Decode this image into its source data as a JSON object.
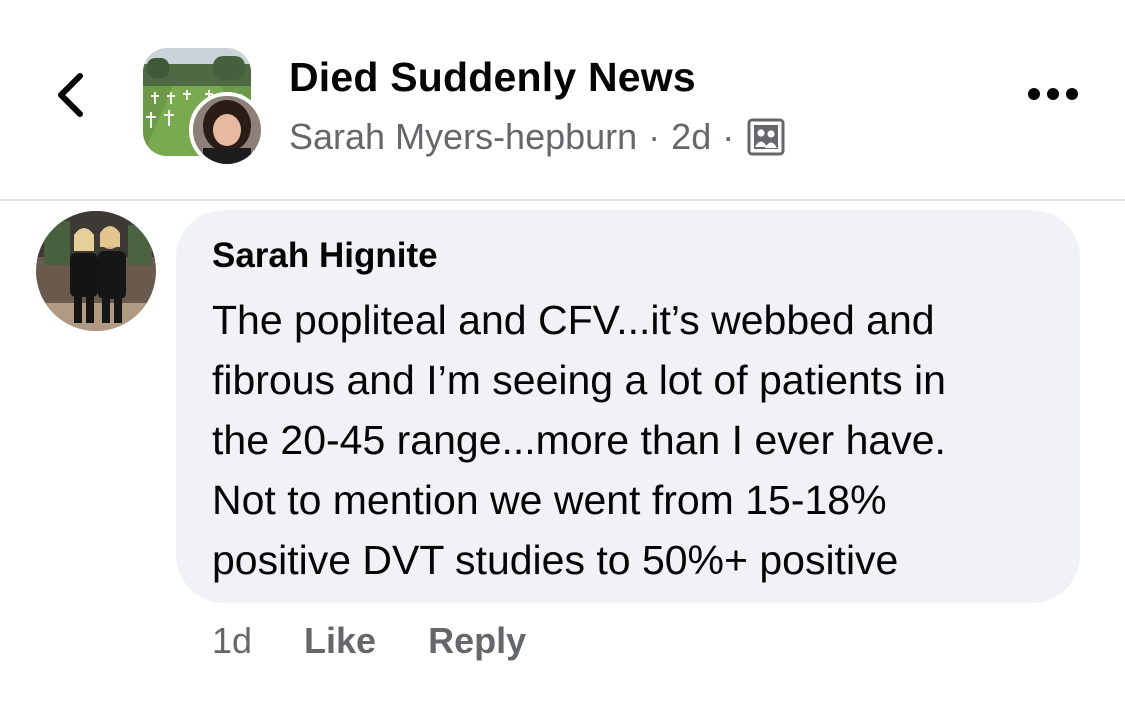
{
  "header": {
    "group_name": "Died Suddenly News",
    "poster_name": "Sarah Myers-hepburn",
    "separator": "·",
    "post_age": "2d",
    "back_icon": "chevron-left-icon",
    "more_icon": "more-horizontal-icon",
    "privacy_icon": "group-members-icon"
  },
  "comment": {
    "author": "Sarah Hignite",
    "lines": [
      "The popliteal and CFV...it’s webbed and",
      "fibrous and I’m seeing a lot of patients in",
      "the 20-45 range...more than I ever have.",
      "Not to mention we went from 15-18%",
      "positive DVT studies to 50%+ positive"
    ],
    "age": "1d",
    "like_label": "Like",
    "reply_label": "Reply"
  },
  "colors": {
    "primary_text": "#050505",
    "secondary_text": "#65676b",
    "bubble_bg": "#f0f2f5",
    "divider": "#dcdde1"
  }
}
